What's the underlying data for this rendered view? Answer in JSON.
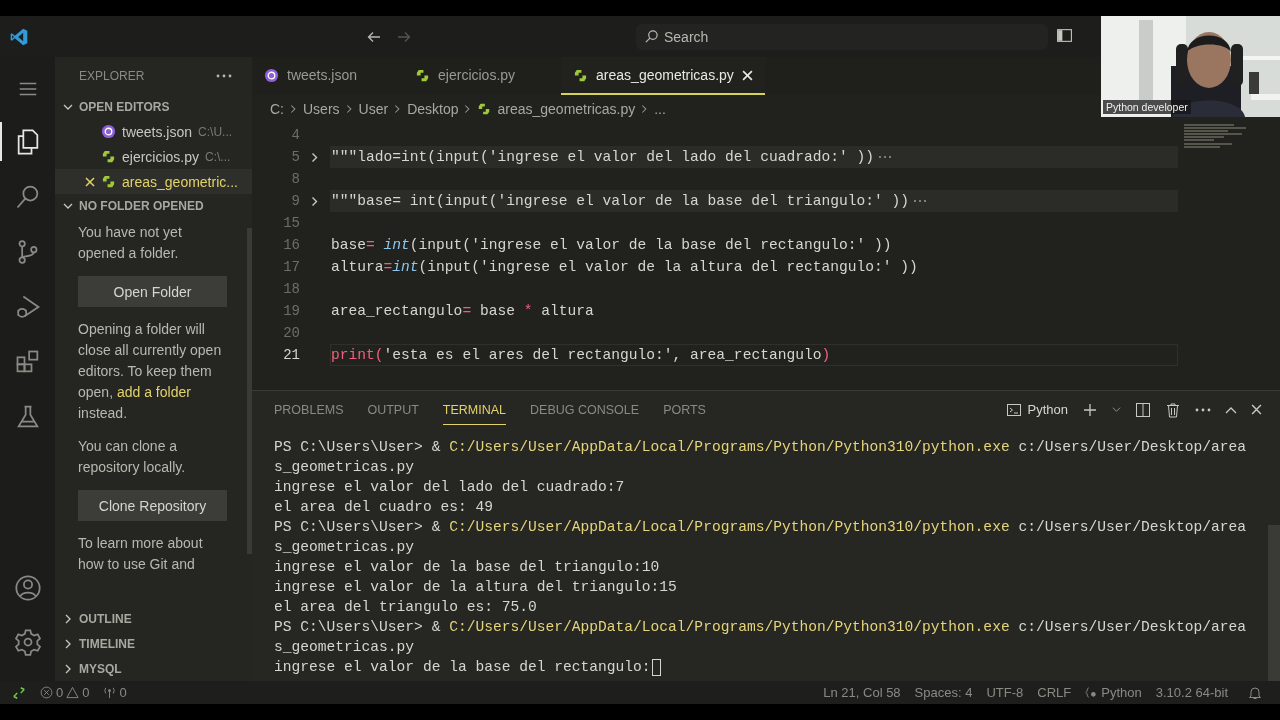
{
  "title_bar": {
    "search": {
      "placeholder": "Search"
    }
  },
  "webcam": {
    "caption": "Python developer"
  },
  "activity_bar": {
    "items": [
      {
        "kind": "files",
        "selected": true
      },
      {
        "kind": "search",
        "selected": false
      },
      {
        "kind": "scm",
        "selected": false
      },
      {
        "kind": "debug",
        "selected": false
      },
      {
        "kind": "extensions",
        "selected": false
      },
      {
        "kind": "testing",
        "selected": false
      }
    ]
  },
  "sidebar": {
    "title": "EXPLORER",
    "open_editors": {
      "title": "OPEN EDITORS",
      "expanded": true,
      "items": [
        {
          "name": "tweets.json",
          "path": "C:\\U...",
          "kind": "json",
          "selected": false
        },
        {
          "name": "ejercicios.py",
          "path": "C:\\...",
          "kind": "python",
          "selected": false
        },
        {
          "name": "areas_geometric...",
          "kind": "python",
          "selected": true
        }
      ]
    },
    "no_folder": {
      "title": "NO FOLDER OPENED",
      "expanded": true,
      "message": "You have not yet opened a folder.",
      "open_button": "Open Folder",
      "warning": {
        "before": "Opening a folder will close all currently open editors. To keep them open, ",
        "link": "add a folder",
        "after": " instead."
      },
      "clone_message": "You can clone a repository locally.",
      "clone_button": "Clone Repository",
      "learn_more": "To learn more about how to use Git and"
    },
    "sections": [
      {
        "title": "OUTLINE",
        "expanded": false
      },
      {
        "title": "TIMELINE",
        "expanded": false
      },
      {
        "title": "MYSQL",
        "expanded": false
      }
    ]
  },
  "tabs": [
    {
      "label": "tweets.json",
      "kind": "json",
      "selected": false
    },
    {
      "label": "ejercicios.py",
      "kind": "python",
      "selected": false
    },
    {
      "label": "areas_geometricas.py",
      "kind": "python",
      "selected": true
    }
  ],
  "breadcrumb": [
    "C:",
    "Users",
    "User",
    "Desktop",
    "areas_geometricas.py",
    "..."
  ],
  "code_lines": [
    {
      "number": "4",
      "folded": false,
      "current": false
    },
    {
      "number": "5",
      "folded": true,
      "current": false,
      "tokens": [
        {
          "text": "\"\"\"lado=int(input('ingrese el valor del lado del cuadrado:' ))",
          "kind": "plain"
        }
      ]
    },
    {
      "number": "8",
      "folded": false,
      "current": false
    },
    {
      "number": "9",
      "folded": true,
      "current": false,
      "tokens": [
        {
          "text": "\"\"\"base= int(input('ingrese el valor de la base del triangulo:' ))",
          "kind": "plain"
        }
      ]
    },
    {
      "number": "15",
      "folded": false,
      "current": false
    },
    {
      "number": "16",
      "folded": false,
      "current": false,
      "tokens": [
        {
          "text": "base",
          "kind": "plain"
        },
        {
          "text": "= ",
          "kind": "op"
        },
        {
          "text": "int",
          "kind": "builtin"
        },
        {
          "text": "(input('ingrese el valor de la base del rectangulo:' ))",
          "kind": "plain"
        }
      ]
    },
    {
      "number": "17",
      "folded": false,
      "current": false,
      "tokens": [
        {
          "text": "altura",
          "kind": "plain"
        },
        {
          "text": "=",
          "kind": "op"
        },
        {
          "text": "int",
          "kind": "builtin"
        },
        {
          "text": "(input('ingrese el valor de la altura del rectangulo:' ))",
          "kind": "plain"
        }
      ]
    },
    {
      "number": "18",
      "folded": false,
      "current": false
    },
    {
      "number": "19",
      "folded": false,
      "current": false,
      "tokens": [
        {
          "text": "area_rectangulo",
          "kind": "plain"
        },
        {
          "text": "= ",
          "kind": "op"
        },
        {
          "text": "base ",
          "kind": "plain"
        },
        {
          "text": "*",
          "kind": "op"
        },
        {
          "text": " altura",
          "kind": "plain"
        }
      ]
    },
    {
      "number": "20",
      "folded": false,
      "current": false
    },
    {
      "number": "21",
      "folded": false,
      "current": true,
      "tokens": [
        {
          "text": "print",
          "kind": "func"
        },
        {
          "text": "(",
          "kind": "op"
        },
        {
          "text": "'esta es el ares del rectangulo:', area_rectangulo",
          "kind": "plain"
        },
        {
          "text": ")",
          "kind": "op"
        }
      ]
    }
  ],
  "panel": {
    "tabs": [
      {
        "label": "PROBLEMS",
        "selected": false
      },
      {
        "label": "OUTPUT",
        "selected": false
      },
      {
        "label": "TERMINAL",
        "selected": true
      },
      {
        "label": "DEBUG CONSOLE",
        "selected": false
      },
      {
        "label": "PORTS",
        "selected": false
      }
    ],
    "terminal_name": "Python",
    "lines": [
      {
        "segments": [
          {
            "text": "PS C:\\Users\\User> & ",
            "kind": "plain"
          },
          {
            "text": "C:/Users/User/AppData/Local/Programs/Python/Python310/python.exe",
            "kind": "path"
          },
          {
            "text": " c:/Users/User/Desktop/area",
            "kind": "plain"
          }
        ]
      },
      {
        "segments": [
          {
            "text": "s_geometricas.py",
            "kind": "plain"
          }
        ]
      },
      {
        "segments": [
          {
            "text": "ingrese el valor del lado del cuadrado:7",
            "kind": "plain"
          }
        ]
      },
      {
        "segments": [
          {
            "text": "el area del cuadro es: 49",
            "kind": "plain"
          }
        ]
      },
      {
        "segments": [
          {
            "text": "PS C:\\Users\\User> & ",
            "kind": "plain"
          },
          {
            "text": "C:/Users/User/AppData/Local/Programs/Python/Python310/python.exe",
            "kind": "path"
          },
          {
            "text": " c:/Users/User/Desktop/area",
            "kind": "plain"
          }
        ]
      },
      {
        "segments": [
          {
            "text": "s_geometricas.py",
            "kind": "plain"
          }
        ]
      },
      {
        "segments": [
          {
            "text": "ingrese el valor de la base del triangulo:10",
            "kind": "plain"
          }
        ]
      },
      {
        "segments": [
          {
            "text": "ingrese el valor de la altura del triangulo:15",
            "kind": "plain"
          }
        ]
      },
      {
        "segments": [
          {
            "text": "el area del triangulo es: 75.0",
            "kind": "plain"
          }
        ]
      },
      {
        "segments": [
          {
            "text": "PS C:\\Users\\User> & ",
            "kind": "plain"
          },
          {
            "text": "C:/Users/User/AppData/Local/Programs/Python/Python310/python.exe",
            "kind": "path"
          },
          {
            "text": " c:/Users/User/Desktop/area",
            "kind": "plain"
          }
        ]
      },
      {
        "segments": [
          {
            "text": "s_geometricas.py",
            "kind": "plain"
          }
        ]
      },
      {
        "cursor": true,
        "segments": [
          {
            "text": "ingrese el valor de la base del rectangulo:",
            "kind": "plain"
          }
        ]
      }
    ]
  },
  "status_bar": {
    "errors": "0",
    "warnings": "0",
    "ports": "0",
    "position": "Ln 21, Col 58",
    "indent": "Spaces: 4",
    "encoding": "UTF-8",
    "eol": "CRLF",
    "language": "Python",
    "interpreter": "3.10.2 64-bit"
  }
}
